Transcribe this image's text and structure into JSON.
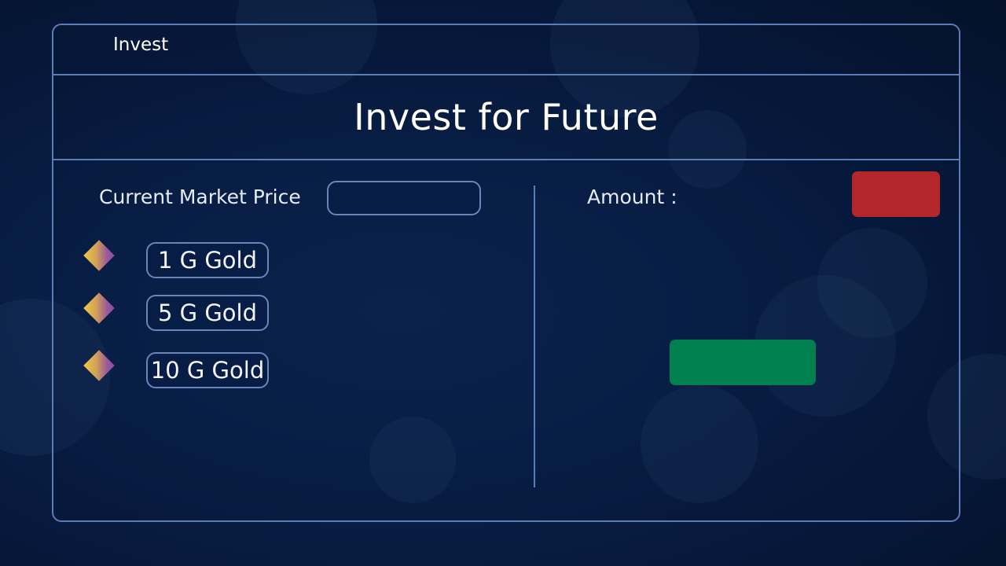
{
  "app": {
    "title": "Invest"
  },
  "header": {
    "title": "Invest for Future"
  },
  "market": {
    "price_label": "Current Market Price",
    "price_value": ""
  },
  "options": [
    {
      "label": "1 G Gold",
      "icon": "diamond-icon"
    },
    {
      "label": "5 G Gold",
      "icon": "diamond-icon"
    },
    {
      "label": "10 G Gold",
      "icon": "diamond-icon"
    }
  ],
  "amount": {
    "label": "Amount :"
  },
  "colors": {
    "accent_border": "#5b7db5",
    "red_button": "#b3262b",
    "green_button": "#007f4f"
  }
}
